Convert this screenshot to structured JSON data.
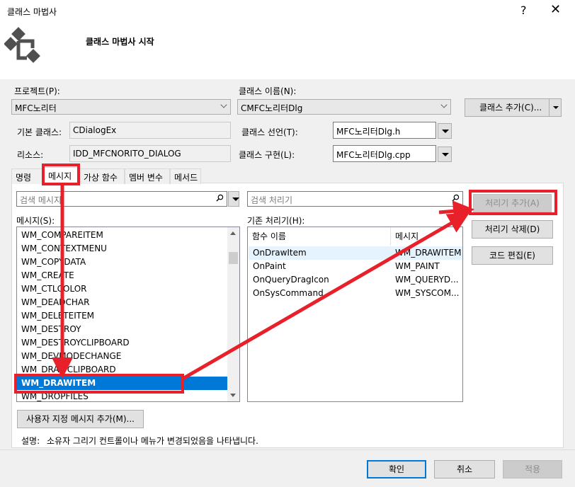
{
  "window": {
    "title": "클래스 마법사",
    "help": "?",
    "close": "✕"
  },
  "header": {
    "heading": "클래스 마법사 시작",
    "logo": "class-wizard-logo-icon"
  },
  "project": {
    "label": "프로젝트(P):",
    "value": "MFC노리터"
  },
  "class_name": {
    "label": "클래스 이름(N):",
    "value": "CMFC노리터Dlg"
  },
  "add_class_button": "클래스 추가(C)...",
  "base_class": {
    "label": "기본 클래스:",
    "value": "CDialogEx"
  },
  "resource": {
    "label": "리소스:",
    "value": "IDD_MFCNORITO_DIALOG"
  },
  "class_decl": {
    "label": "클래스 선언(T):",
    "value": "MFC노리터Dlg.h"
  },
  "class_impl": {
    "label": "클래스 구현(L):",
    "value": "MFC노리터Dlg.cpp"
  },
  "tabs": [
    "명령",
    "메시지",
    "가상 함수",
    "멤버 변수",
    "메서드"
  ],
  "active_tab": "메시지",
  "message_search_placeholder": "검색 메시지",
  "handler_search_placeholder": "검색 처리기",
  "messages_label": "메시지(S):",
  "messages": [
    "WM_COMPAREITEM",
    "WM_CONTEXTMENU",
    "WM_COPYDATA",
    "WM_CREATE",
    "WM_CTLCOLOR",
    "WM_DEADCHAR",
    "WM_DELETEITEM",
    "WM_DESTROY",
    "WM_DESTROYCLIPBOARD",
    "WM_DEVMODECHANGE",
    "WM_DRAWCLIPBOARD",
    "WM_DRAWITEM",
    "WM_DROPFILES"
  ],
  "selected_message": "WM_DRAWITEM",
  "handlers_label": "기존 처리기(H):",
  "handler_columns": [
    "함수 이름",
    "메시지"
  ],
  "handlers": [
    {
      "func": "OnDrawItem",
      "msg": "WM_DRAWITEM"
    },
    {
      "func": "OnPaint",
      "msg": "WM_PAINT"
    },
    {
      "func": "OnQueryDragIcon",
      "msg": "WM_QUERYD..."
    },
    {
      "func": "OnSysCommand",
      "msg": "WM_SYSCOM..."
    }
  ],
  "buttons": {
    "add_handler": "처리기 추가(A)",
    "delete_handler": "처리기 삭제(D)",
    "edit_code": "코드 편집(E)",
    "add_custom": "사용자 지정 메시지 추가(M)..."
  },
  "description": {
    "label": "설명:",
    "text": "소유자 그리기 컨트롤이나 메뉴가 변경되었음을 나타냅니다."
  },
  "footer": {
    "ok": "확인",
    "cancel": "취소",
    "apply": "적용"
  },
  "annotation_color": "#e8202a",
  "selection_color": "#0078d7"
}
